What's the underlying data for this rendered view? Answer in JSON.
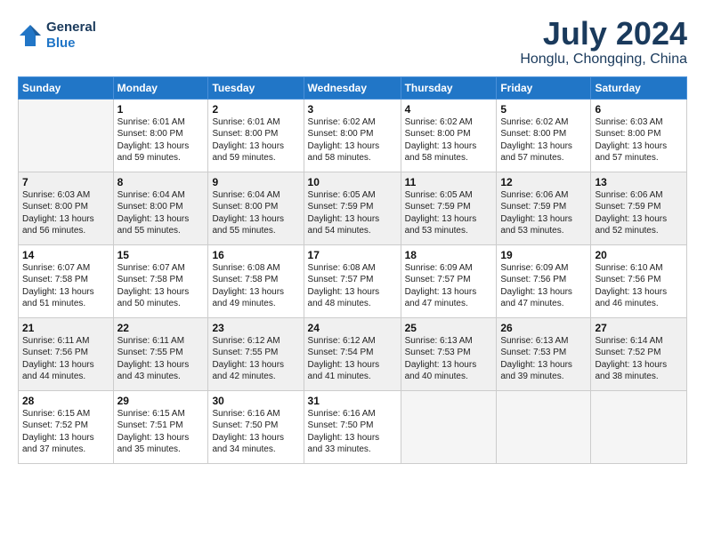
{
  "header": {
    "logo_line1": "General",
    "logo_line2": "Blue",
    "month": "July 2024",
    "location": "Honglu, Chongqing, China"
  },
  "weekdays": [
    "Sunday",
    "Monday",
    "Tuesday",
    "Wednesday",
    "Thursday",
    "Friday",
    "Saturday"
  ],
  "weeks": [
    [
      {
        "day": "",
        "info": ""
      },
      {
        "day": "1",
        "info": "Sunrise: 6:01 AM\nSunset: 8:00 PM\nDaylight: 13 hours\nand 59 minutes."
      },
      {
        "day": "2",
        "info": "Sunrise: 6:01 AM\nSunset: 8:00 PM\nDaylight: 13 hours\nand 59 minutes."
      },
      {
        "day": "3",
        "info": "Sunrise: 6:02 AM\nSunset: 8:00 PM\nDaylight: 13 hours\nand 58 minutes."
      },
      {
        "day": "4",
        "info": "Sunrise: 6:02 AM\nSunset: 8:00 PM\nDaylight: 13 hours\nand 58 minutes."
      },
      {
        "day": "5",
        "info": "Sunrise: 6:02 AM\nSunset: 8:00 PM\nDaylight: 13 hours\nand 57 minutes."
      },
      {
        "day": "6",
        "info": "Sunrise: 6:03 AM\nSunset: 8:00 PM\nDaylight: 13 hours\nand 57 minutes."
      }
    ],
    [
      {
        "day": "7",
        "info": "Sunrise: 6:03 AM\nSunset: 8:00 PM\nDaylight: 13 hours\nand 56 minutes."
      },
      {
        "day": "8",
        "info": "Sunrise: 6:04 AM\nSunset: 8:00 PM\nDaylight: 13 hours\nand 55 minutes."
      },
      {
        "day": "9",
        "info": "Sunrise: 6:04 AM\nSunset: 8:00 PM\nDaylight: 13 hours\nand 55 minutes."
      },
      {
        "day": "10",
        "info": "Sunrise: 6:05 AM\nSunset: 7:59 PM\nDaylight: 13 hours\nand 54 minutes."
      },
      {
        "day": "11",
        "info": "Sunrise: 6:05 AM\nSunset: 7:59 PM\nDaylight: 13 hours\nand 53 minutes."
      },
      {
        "day": "12",
        "info": "Sunrise: 6:06 AM\nSunset: 7:59 PM\nDaylight: 13 hours\nand 53 minutes."
      },
      {
        "day": "13",
        "info": "Sunrise: 6:06 AM\nSunset: 7:59 PM\nDaylight: 13 hours\nand 52 minutes."
      }
    ],
    [
      {
        "day": "14",
        "info": "Sunrise: 6:07 AM\nSunset: 7:58 PM\nDaylight: 13 hours\nand 51 minutes."
      },
      {
        "day": "15",
        "info": "Sunrise: 6:07 AM\nSunset: 7:58 PM\nDaylight: 13 hours\nand 50 minutes."
      },
      {
        "day": "16",
        "info": "Sunrise: 6:08 AM\nSunset: 7:58 PM\nDaylight: 13 hours\nand 49 minutes."
      },
      {
        "day": "17",
        "info": "Sunrise: 6:08 AM\nSunset: 7:57 PM\nDaylight: 13 hours\nand 48 minutes."
      },
      {
        "day": "18",
        "info": "Sunrise: 6:09 AM\nSunset: 7:57 PM\nDaylight: 13 hours\nand 47 minutes."
      },
      {
        "day": "19",
        "info": "Sunrise: 6:09 AM\nSunset: 7:56 PM\nDaylight: 13 hours\nand 47 minutes."
      },
      {
        "day": "20",
        "info": "Sunrise: 6:10 AM\nSunset: 7:56 PM\nDaylight: 13 hours\nand 46 minutes."
      }
    ],
    [
      {
        "day": "21",
        "info": "Sunrise: 6:11 AM\nSunset: 7:56 PM\nDaylight: 13 hours\nand 44 minutes."
      },
      {
        "day": "22",
        "info": "Sunrise: 6:11 AM\nSunset: 7:55 PM\nDaylight: 13 hours\nand 43 minutes."
      },
      {
        "day": "23",
        "info": "Sunrise: 6:12 AM\nSunset: 7:55 PM\nDaylight: 13 hours\nand 42 minutes."
      },
      {
        "day": "24",
        "info": "Sunrise: 6:12 AM\nSunset: 7:54 PM\nDaylight: 13 hours\nand 41 minutes."
      },
      {
        "day": "25",
        "info": "Sunrise: 6:13 AM\nSunset: 7:53 PM\nDaylight: 13 hours\nand 40 minutes."
      },
      {
        "day": "26",
        "info": "Sunrise: 6:13 AM\nSunset: 7:53 PM\nDaylight: 13 hours\nand 39 minutes."
      },
      {
        "day": "27",
        "info": "Sunrise: 6:14 AM\nSunset: 7:52 PM\nDaylight: 13 hours\nand 38 minutes."
      }
    ],
    [
      {
        "day": "28",
        "info": "Sunrise: 6:15 AM\nSunset: 7:52 PM\nDaylight: 13 hours\nand 37 minutes."
      },
      {
        "day": "29",
        "info": "Sunrise: 6:15 AM\nSunset: 7:51 PM\nDaylight: 13 hours\nand 35 minutes."
      },
      {
        "day": "30",
        "info": "Sunrise: 6:16 AM\nSunset: 7:50 PM\nDaylight: 13 hours\nand 34 minutes."
      },
      {
        "day": "31",
        "info": "Sunrise: 6:16 AM\nSunset: 7:50 PM\nDaylight: 13 hours\nand 33 minutes."
      },
      {
        "day": "",
        "info": ""
      },
      {
        "day": "",
        "info": ""
      },
      {
        "day": "",
        "info": ""
      }
    ]
  ]
}
